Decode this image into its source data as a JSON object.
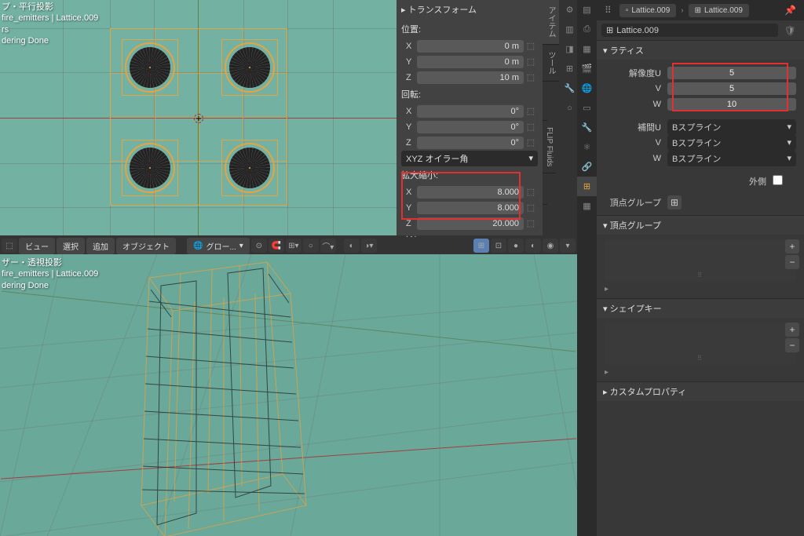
{
  "viewport_top": {
    "overlay_lines": [
      "プ・平行投影",
      "fire_emitters | Lattice.009",
      "rs",
      "dering Done"
    ]
  },
  "viewport_bottom": {
    "overlay_lines": [
      "ザー・透視投影",
      "fire_emitters | Lattice.009",
      "dering Done"
    ]
  },
  "toolbar": {
    "view": "ビュー",
    "select": "選択",
    "add": "追加",
    "object": "オブジェクト",
    "mode_dropdown": "グロー..."
  },
  "transform": {
    "title": "トランスフォーム",
    "position_label": "位置:",
    "rotation_label": "回転:",
    "scale_label": "拡大縮小:",
    "dimensions_label": "寸法:",
    "euler_label": "XYZ オイラー角",
    "position": {
      "x": "0 m",
      "y": "0 m",
      "z": "10 m"
    },
    "rotation": {
      "x": "0°",
      "y": "0°",
      "z": "0°"
    },
    "scale": {
      "x": "8.000",
      "y": "8.000",
      "z": "20.000"
    },
    "axis": {
      "x": "X",
      "y": "Y",
      "z": "Z"
    }
  },
  "n_tabs": [
    "アイテム",
    "ツール",
    "FLIP Fluids"
  ],
  "breadcrumb": {
    "obj": "Lattice.009",
    "data": "Lattice.009"
  },
  "lattice": {
    "data_name": "Lattice.009",
    "panel_title": "ラティス",
    "res_u_label": "解像度U",
    "res_v_label": "V",
    "res_w_label": "W",
    "res_u": "5",
    "res_v": "5",
    "res_w": "10",
    "interp_u_label": "補間U",
    "interp_v_label": "V",
    "interp_w_label": "W",
    "interp": "Bスプライン",
    "outside_label": "外側",
    "vgroup_label": "頂点グループ"
  },
  "panels": {
    "vertex_groups": "頂点グループ",
    "shape_keys": "シェイプキー",
    "custom_props": "カスタムプロパティ"
  }
}
